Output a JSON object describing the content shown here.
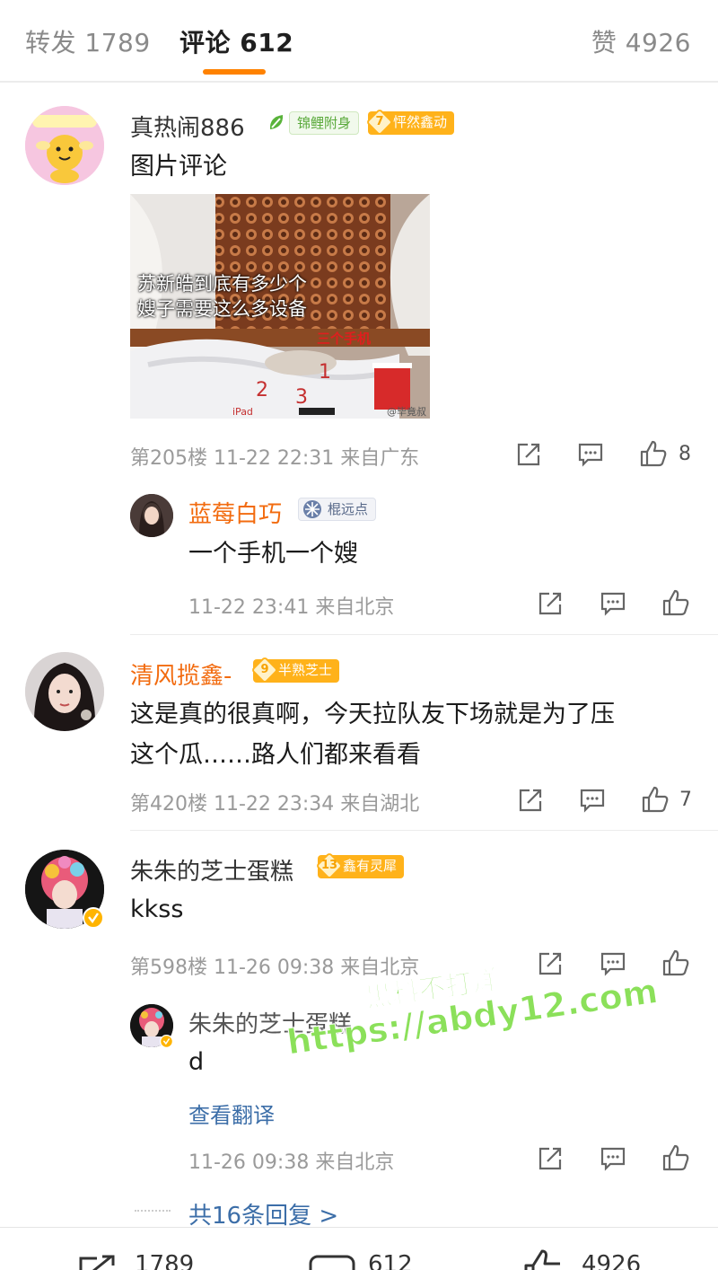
{
  "tabs": {
    "repost": "转发 1789",
    "comments": "评论 612",
    "likes": "赞 4926"
  },
  "comments": [
    {
      "username": "真热闹886",
      "badge1": "锦鲤附身",
      "badge2_level": "7",
      "badge2": "怦然鑫动",
      "text": "图片评论",
      "image_text_line1": "苏新皓到底有多少个",
      "image_text_line2": "嫂子需要这么多设备",
      "image_label": "三个手机",
      "image_nums": [
        "1",
        "2",
        "3"
      ],
      "image_corner_left": "iPad",
      "image_corner_right": "@毕竟叔",
      "meta": "第205楼  11-22 22:31  来自广东",
      "likes": "8",
      "reply": {
        "username": "蓝莓白巧",
        "badge": "棍远点",
        "text": "一个手机一个嫂",
        "meta": "11-22 23:41  来自北京"
      }
    },
    {
      "username": "清风揽鑫-",
      "badge_level": "9",
      "badge": "半熟芝士",
      "text_line1": "这是真的很真啊，今天拉队友下场就是为了压",
      "text_line2": "这个瓜……路人们都来看看",
      "meta": "第420楼  11-22 23:34  来自湖北",
      "likes": "7"
    },
    {
      "username": "朱朱的芝士蛋糕",
      "badge_level": "13",
      "badge": "鑫有灵犀",
      "text": "kkss",
      "meta": "第598楼  11-26 09:38  来自北京",
      "reply": {
        "username": "朱朱的芝士蛋糕",
        "text": "d",
        "translate": "查看翻译",
        "meta": "11-26 09:38  来自北京"
      },
      "more_replies": "共16条回复 >"
    }
  ],
  "watermark": {
    "line1": "黑料不打烊",
    "line2": "https://abdy12.com"
  },
  "bottom_bar": {
    "repost": "1789",
    "comments": "612",
    "likes": "4926"
  },
  "colors": {
    "accent": "#ff8200",
    "vip_name": "#f26b0f",
    "link": "#3c6ea8"
  }
}
